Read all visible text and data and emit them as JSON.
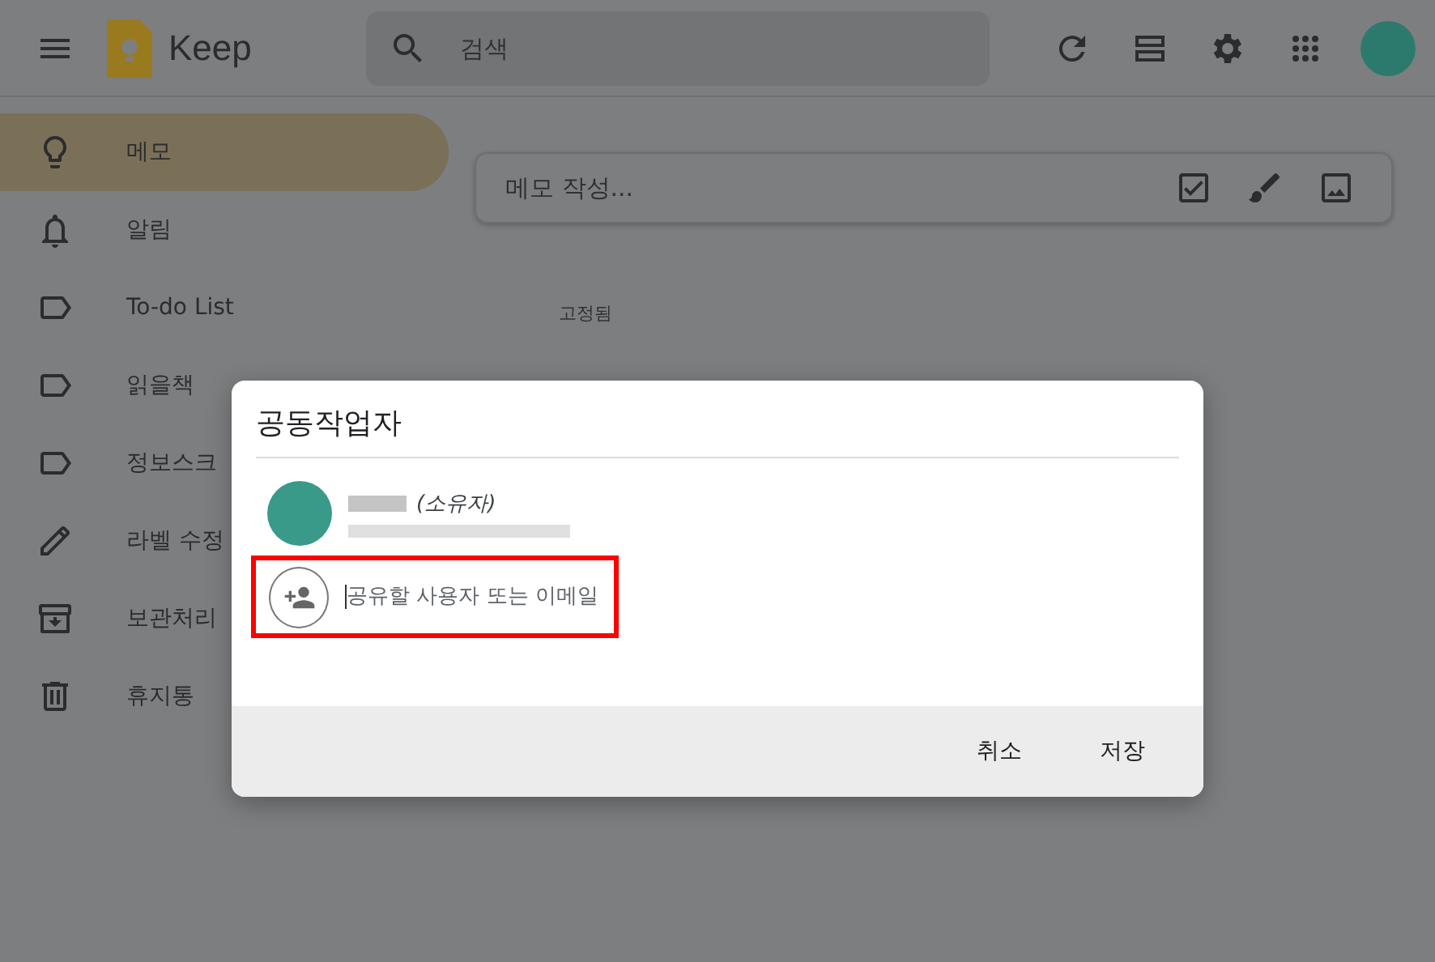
{
  "header": {
    "app_name": "Keep",
    "search": {
      "placeholder": "검색"
    }
  },
  "sidebar": {
    "items": [
      {
        "kind": "notes",
        "label": "메모",
        "selected": true
      },
      {
        "kind": "reminders",
        "label": "알림",
        "selected": false
      },
      {
        "kind": "label",
        "label": "To-do List",
        "selected": false
      },
      {
        "kind": "label",
        "label": "읽을책",
        "selected": false
      },
      {
        "kind": "label",
        "label": "정보스크",
        "selected": false
      },
      {
        "kind": "edit",
        "label": "라벨 수정",
        "selected": false
      },
      {
        "kind": "archive",
        "label": "보관처리",
        "selected": false
      },
      {
        "kind": "trash",
        "label": "휴지통",
        "selected": false
      }
    ]
  },
  "note_input": {
    "placeholder": "메모 작성..."
  },
  "pinned_heading": "고정됨",
  "dialog": {
    "title": "공동작업자",
    "owner": {
      "role": "(소유자)"
    },
    "invite": {
      "placeholder": "공유할 사용자 또는 이메일",
      "highlighted": true
    },
    "buttons": [
      "취소",
      "저장"
    ]
  }
}
